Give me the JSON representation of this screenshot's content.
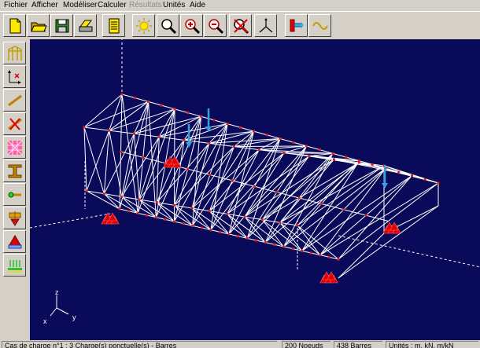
{
  "menu": [
    "Fichier",
    "Afficher",
    "Modéliser",
    "Calculer",
    "Résultats",
    "Unités",
    "Aide"
  ],
  "menu_disabled": "Résultats",
  "toolbar": {
    "buttons": [
      "new-file",
      "open-folder",
      "save",
      "print",
      "page-properties",
      "light",
      "zoom",
      "zoom-in",
      "zoom-out",
      "zoom-reset",
      "axes-3d",
      "hammer",
      "wave"
    ]
  },
  "sidebar": {
    "buttons": [
      "structure",
      "axes",
      "bar",
      "delete-bar",
      "mesh",
      "section-profile",
      "node",
      "support",
      "load",
      "distributed-load"
    ]
  },
  "viewport": {
    "axis_labels": {
      "z": "z",
      "x": "x",
      "y": "y"
    },
    "background": "#0a0a5a",
    "member_color": "#ffffff",
    "node_color": "#e02020",
    "load_color": "#3aa0e0"
  },
  "status": {
    "message": "Cas de charge n°1 : 3 Charge(s) ponctuelle(s) - Barres",
    "nodes": "200 Noeuds",
    "bars": "438 Barres",
    "units": "Unités : m, kN, m/kN"
  }
}
